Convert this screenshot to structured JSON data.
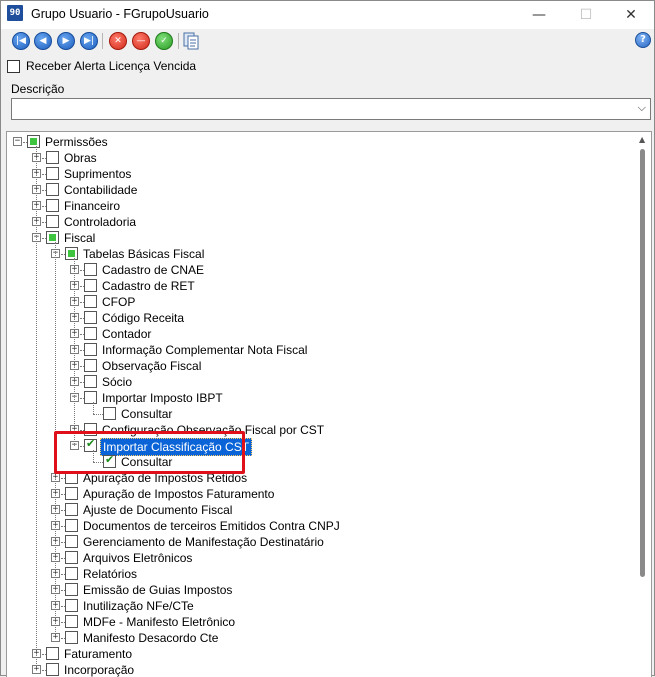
{
  "window": {
    "app_icon_text": "90",
    "title": "Grupo Usuario - FGrupoUsuario",
    "minimize_glyph": "—",
    "maximize_glyph": "☐",
    "close_glyph": "✕"
  },
  "toolbar": {
    "first_icon": "first-record-icon",
    "prev_icon": "previous-record-icon",
    "next_icon": "next-record-icon",
    "last_icon": "last-record-icon",
    "cancel_icon": "cancel-icon",
    "remove_icon": "remove-icon",
    "confirm_icon": "confirm-icon",
    "copy_icon": "copy-document-icon",
    "help_label": "?",
    "glyphs": {
      "first": "|◀",
      "prev": "◀",
      "next": "▶",
      "last": "▶|",
      "cancel": "✕",
      "remove": "—",
      "ok": "✓"
    }
  },
  "form": {
    "alert_label": "Receber Alerta Licença Vencida",
    "alert_checked": false,
    "descricao_label": "Descrição",
    "descricao_value": "",
    "combo_arrow": "⌵"
  },
  "colors": {
    "partial_check": "#3ec43e",
    "selection_bg": "#0a64d8",
    "annotation_red": "#e0101a"
  },
  "tree": {
    "nodes": [
      {
        "label": "Permissões",
        "depth": 0,
        "state": "partial",
        "expander": "−"
      },
      {
        "label": "Obras",
        "depth": 1,
        "state": "none",
        "expander": "+"
      },
      {
        "label": "Suprimentos",
        "depth": 1,
        "state": "none",
        "expander": "+"
      },
      {
        "label": "Contabilidade",
        "depth": 1,
        "state": "none",
        "expander": "+"
      },
      {
        "label": "Financeiro",
        "depth": 1,
        "state": "none",
        "expander": "+"
      },
      {
        "label": "Controladoria",
        "depth": 1,
        "state": "none",
        "expander": "+"
      },
      {
        "label": "Fiscal",
        "depth": 1,
        "state": "partial",
        "expander": "−"
      },
      {
        "label": "Tabelas Básicas Fiscal",
        "depth": 2,
        "state": "partial",
        "expander": "−"
      },
      {
        "label": "Cadastro de CNAE",
        "depth": 3,
        "state": "none",
        "expander": "+"
      },
      {
        "label": "Cadastro de RET",
        "depth": 3,
        "state": "none",
        "expander": "+"
      },
      {
        "label": "CFOP",
        "depth": 3,
        "state": "none",
        "expander": "+"
      },
      {
        "label": "Código Receita",
        "depth": 3,
        "state": "none",
        "expander": "+"
      },
      {
        "label": "Contador",
        "depth": 3,
        "state": "none",
        "expander": "+"
      },
      {
        "label": "Informação Complementar Nota Fiscal",
        "depth": 3,
        "state": "none",
        "expander": "+"
      },
      {
        "label": "Observação Fiscal",
        "depth": 3,
        "state": "none",
        "expander": "+"
      },
      {
        "label": "Sócio",
        "depth": 3,
        "state": "none",
        "expander": "+"
      },
      {
        "label": "Importar Imposto IBPT",
        "depth": 3,
        "state": "none",
        "expander": "−"
      },
      {
        "label": "Consultar",
        "depth": 4,
        "state": "none",
        "expander": ""
      },
      {
        "label": "Configuração Observação Fiscal por CST",
        "depth": 3,
        "state": "none",
        "expander": "+"
      },
      {
        "label": "Importar Classificação CST",
        "depth": 3,
        "state": "checked",
        "expander": "−",
        "selected": true
      },
      {
        "label": "Consultar",
        "depth": 4,
        "state": "checked",
        "expander": ""
      },
      {
        "label": "Apuração de Impostos Retidos",
        "depth": 2,
        "state": "none",
        "expander": "+"
      },
      {
        "label": "Apuração de Impostos Faturamento",
        "depth": 2,
        "state": "none",
        "expander": "+"
      },
      {
        "label": "Ajuste de Documento Fiscal",
        "depth": 2,
        "state": "none",
        "expander": "+"
      },
      {
        "label": "Documentos de terceiros Emitidos Contra CNPJ",
        "depth": 2,
        "state": "none",
        "expander": "+"
      },
      {
        "label": "Gerenciamento de Manifestação Destinatário",
        "depth": 2,
        "state": "none",
        "expander": "+"
      },
      {
        "label": "Arquivos Eletrônicos",
        "depth": 2,
        "state": "none",
        "expander": "+"
      },
      {
        "label": "Relatórios",
        "depth": 2,
        "state": "none",
        "expander": "+"
      },
      {
        "label": "Emissão de Guias Impostos",
        "depth": 2,
        "state": "none",
        "expander": "+"
      },
      {
        "label": "Inutilização NFe/CTe",
        "depth": 2,
        "state": "none",
        "expander": "+"
      },
      {
        "label": "MDFe - Manifesto Eletrônico",
        "depth": 2,
        "state": "none",
        "expander": "+"
      },
      {
        "label": "Manifesto Desacordo Cte",
        "depth": 2,
        "state": "none",
        "expander": "+"
      },
      {
        "label": "Faturamento",
        "depth": 1,
        "state": "none",
        "expander": "+"
      },
      {
        "label": "Incorporação",
        "depth": 1,
        "state": "none",
        "expander": "+"
      }
    ]
  }
}
